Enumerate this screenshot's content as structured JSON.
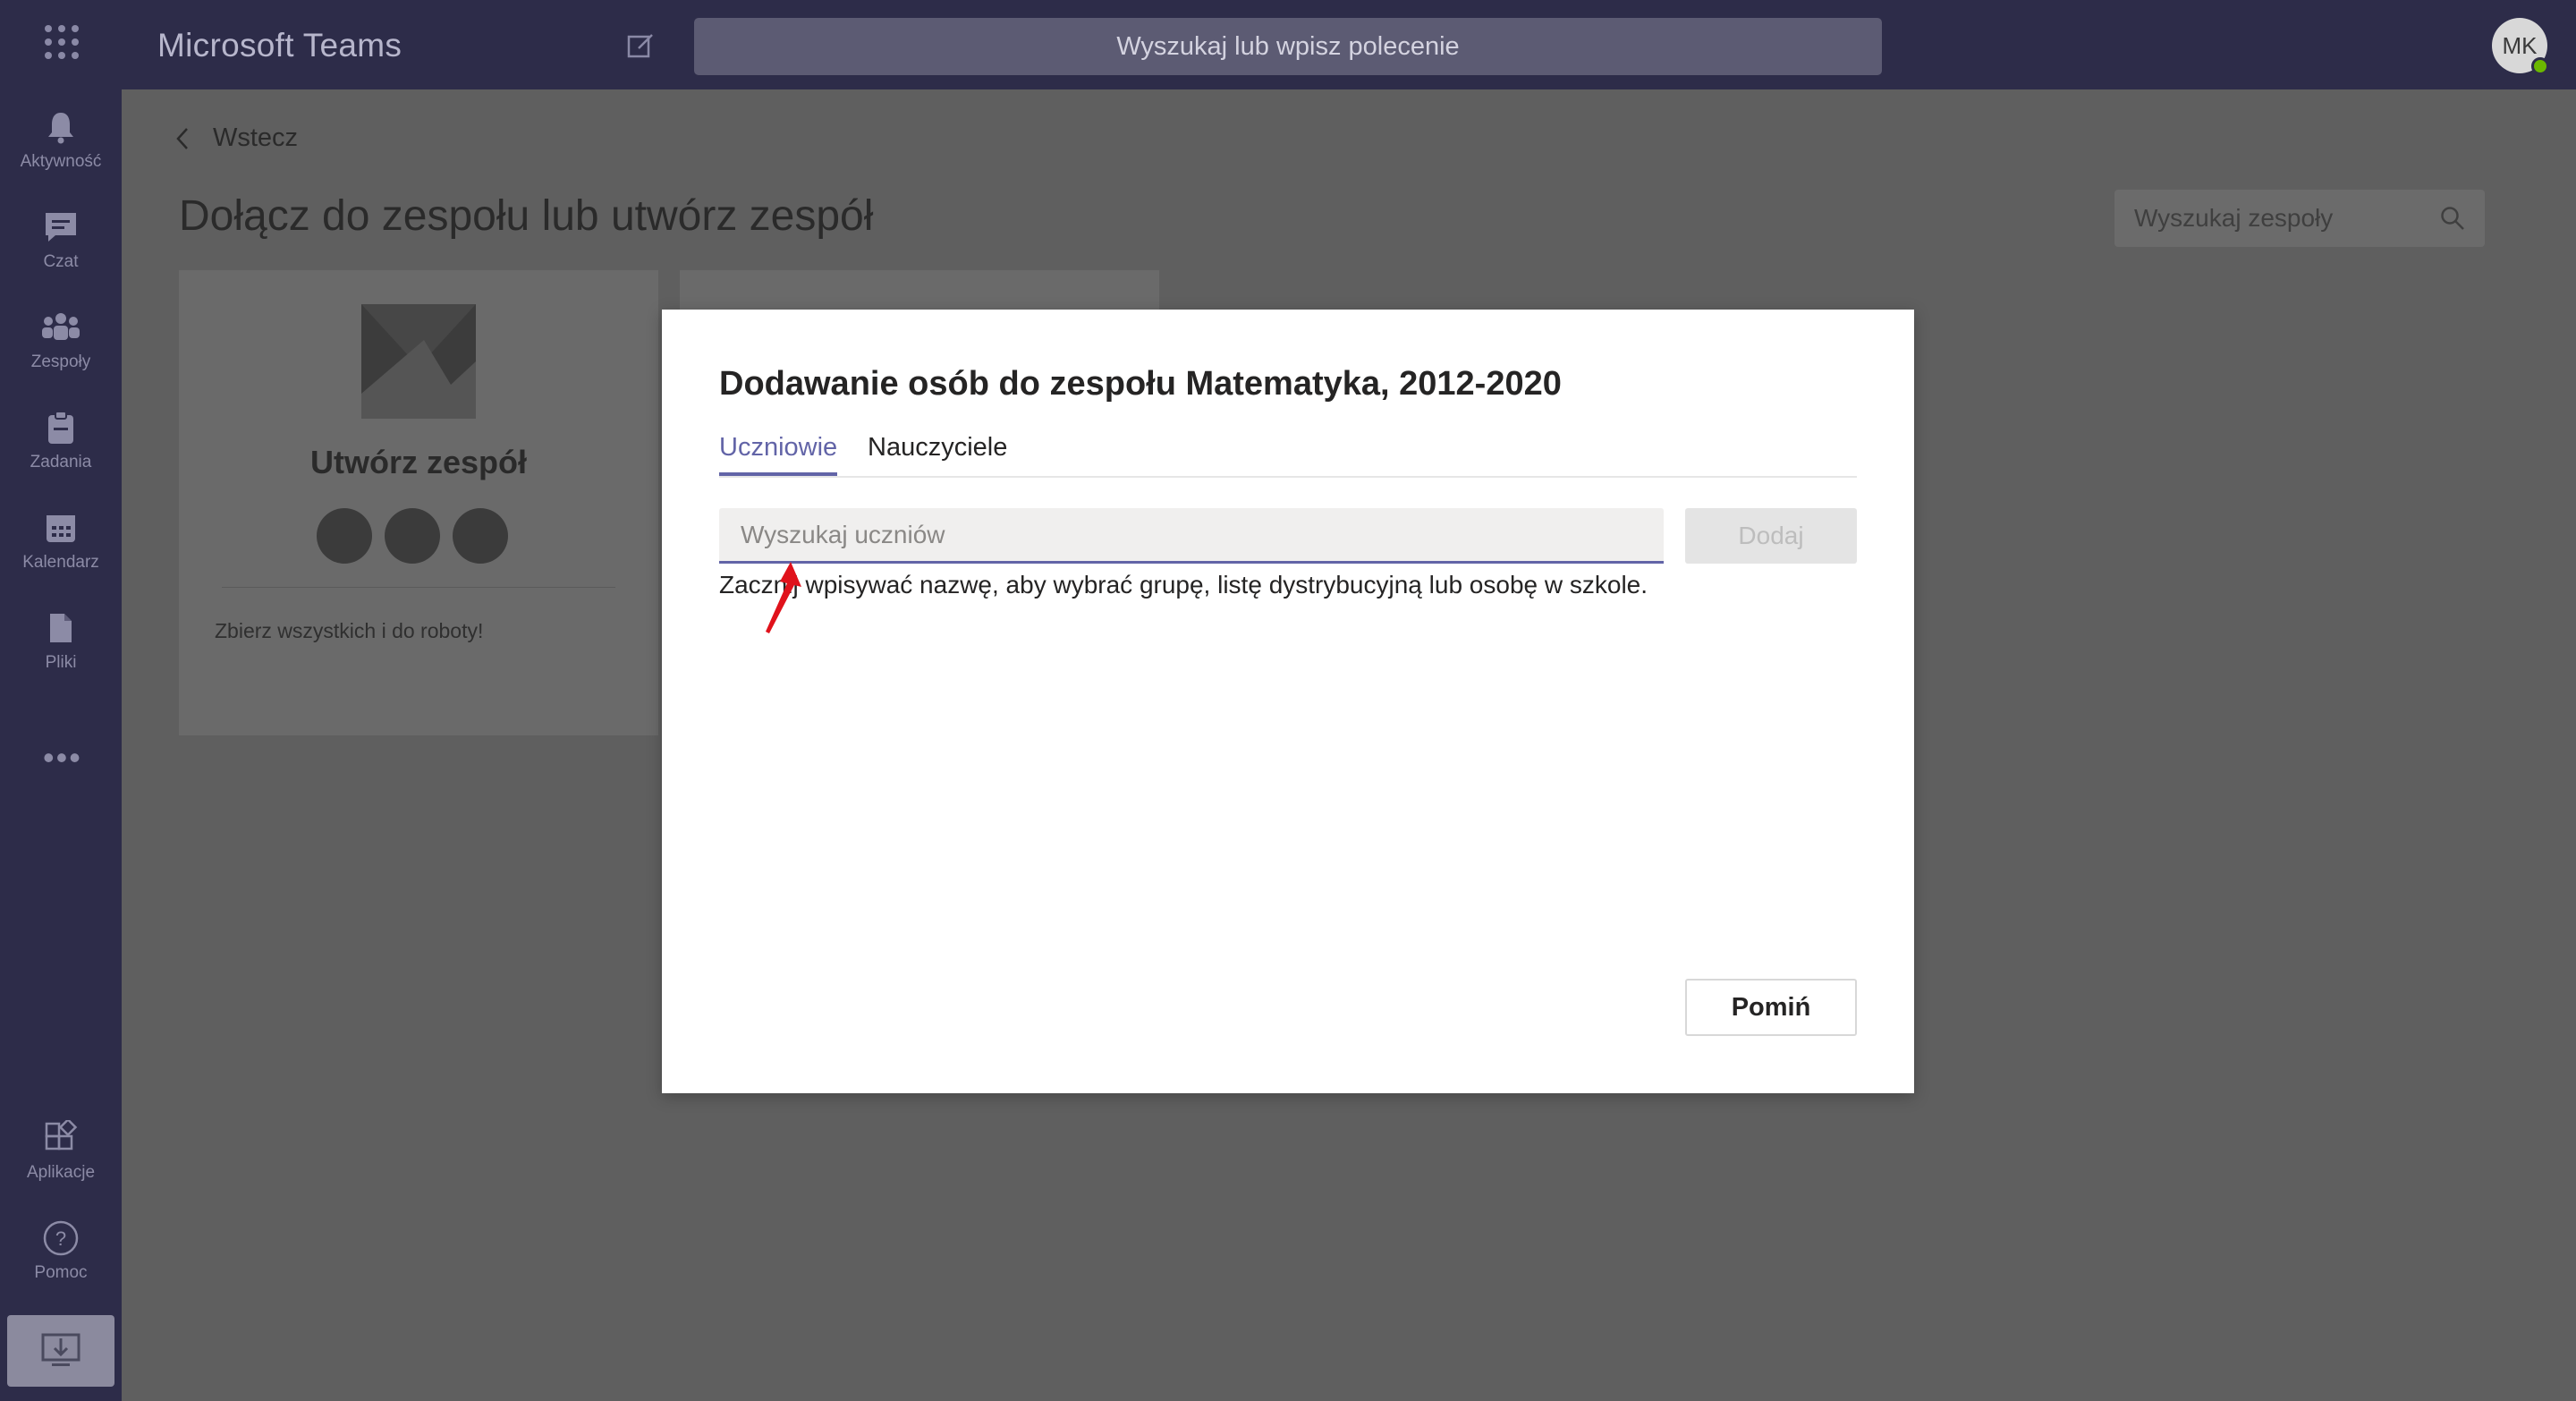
{
  "titlebar": {
    "app_title": "Microsoft Teams",
    "search_placeholder": "Wyszukaj lub wpisz polecenie",
    "avatar_initials": "MK"
  },
  "rail": {
    "items": [
      {
        "label": "Aktywność",
        "icon": "bell-icon"
      },
      {
        "label": "Czat",
        "icon": "chat-icon"
      },
      {
        "label": "Zespoły",
        "icon": "teams-icon"
      },
      {
        "label": "Zadania",
        "icon": "assignments-icon"
      },
      {
        "label": "Kalendarz",
        "icon": "calendar-icon"
      },
      {
        "label": "Pliki",
        "icon": "files-icon"
      }
    ],
    "more": "•••",
    "bottom_items": [
      {
        "label": "Aplikacje",
        "icon": "apps-icon"
      },
      {
        "label": "Pomoc",
        "icon": "help-icon"
      }
    ]
  },
  "page": {
    "back_label": "Wstecz",
    "title": "Dołącz do zespołu lub utwórz zespół",
    "team_search_placeholder": "Wyszukaj zespoły",
    "create_card": {
      "title": "Utwórz zespół",
      "text": "Zbierz wszystkich i do roboty!"
    }
  },
  "dialog": {
    "title": "Dodawanie osób do zespołu Matematyka, 2012-2020",
    "tabs": [
      {
        "label": "Uczniowie",
        "active": true
      },
      {
        "label": "Nauczyciele",
        "active": false
      }
    ],
    "search_placeholder": "Wyszukaj uczniów",
    "add_label": "Dodaj",
    "hint": "Zacznij wpisywać nazwę, aby wybrać grupę, listę dystrybucyjną lub osobę w szkole.",
    "skip_label": "Pomiń"
  },
  "colors": {
    "accent": "#6264a7",
    "titlebar": "#2d2c49",
    "annotation_arrow": "#e0121b"
  }
}
